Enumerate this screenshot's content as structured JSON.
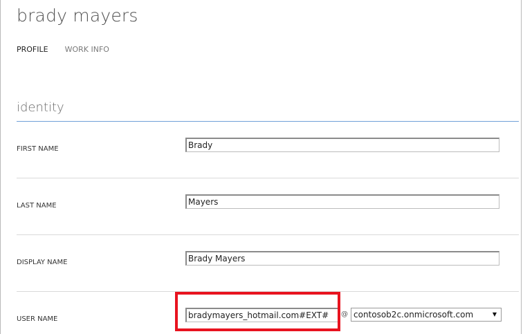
{
  "header": {
    "title": "brady mayers"
  },
  "tabs": [
    {
      "label": "PROFILE",
      "active": true
    },
    {
      "label": "WORK INFO",
      "active": false
    }
  ],
  "section": {
    "title": "identity"
  },
  "fields": {
    "first_name": {
      "label": "FIRST NAME",
      "value": "Brady"
    },
    "last_name": {
      "label": "LAST NAME",
      "value": "Mayers"
    },
    "display_name": {
      "label": "DISPLAY NAME",
      "value": "Brady Mayers"
    },
    "user_name": {
      "label": "USER NAME",
      "value": "bradymayers_hotmail.com#EXT#",
      "at": "@",
      "domain": "contosob2c.onmicrosoft.com",
      "domain_arrow": "▼"
    }
  },
  "colors": {
    "highlight": "#e8131f",
    "section_rule": "#6fa0d8"
  }
}
